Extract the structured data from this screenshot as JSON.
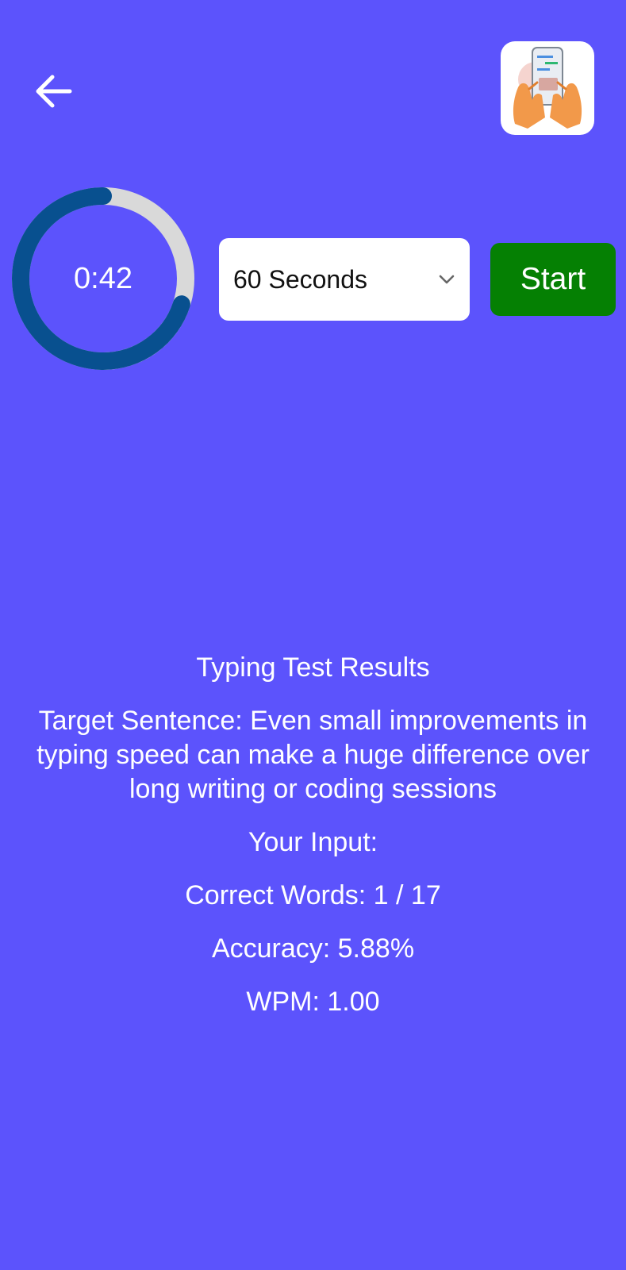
{
  "header": {
    "back_icon": "arrow-left-icon",
    "logo_icon": "hands-typing-phone-logo"
  },
  "timer": {
    "display": "0:42",
    "remaining_fraction": 0.7,
    "progress_color": "#08508f",
    "track_color": "#d9d9d9"
  },
  "duration_select": {
    "selected": "60 Seconds",
    "icon": "chevron-down-icon"
  },
  "start_button": {
    "label": "Start",
    "color": "#058003"
  },
  "results": {
    "title": "Typing Test Results",
    "target_sentence": "Target Sentence: Even small improvements in typing speed can make a huge difference over long writing or coding sessions",
    "your_input": "Your Input:",
    "correct_words": "Correct Words: 1 / 17",
    "accuracy": "Accuracy: 5.88%",
    "wpm": "WPM: 1.00"
  },
  "colors": {
    "background": "#5c53fc",
    "text": "#ffffff"
  }
}
